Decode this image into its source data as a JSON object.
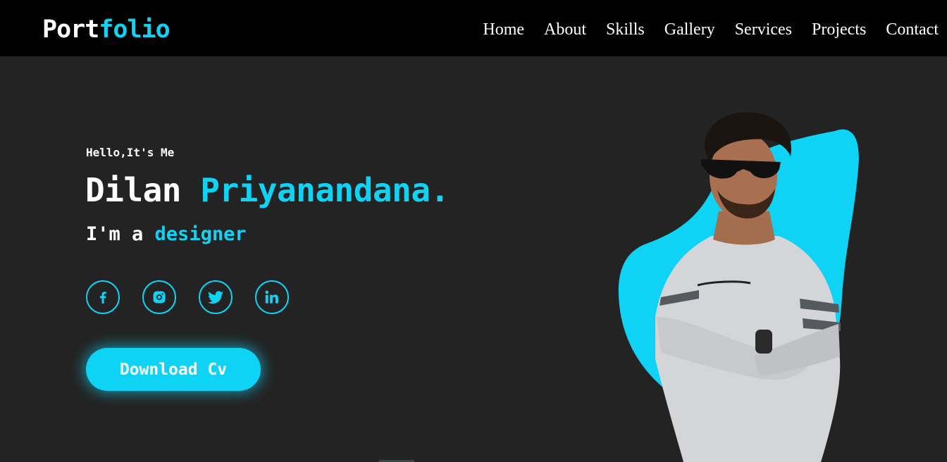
{
  "header": {
    "logo_part1": "Port",
    "logo_part2": "folio",
    "nav": [
      "Home",
      "About",
      "Skills",
      "Gallery",
      "Services",
      "Projects",
      "Contact"
    ]
  },
  "hero": {
    "greeting": "Hello,It's Me",
    "first_name": "Dilan",
    "last_name": "Priyanandana.",
    "role_prefix": "I'm a",
    "role": "designer",
    "social_icons": [
      "facebook-icon",
      "instagram-icon",
      "twitter-icon",
      "linkedin-icon"
    ],
    "cta_label": "Download Cv"
  },
  "colors": {
    "accent": "#0ed3f5",
    "nav_background": "#000000",
    "page_background": "#232323",
    "text": "#ffffff"
  }
}
